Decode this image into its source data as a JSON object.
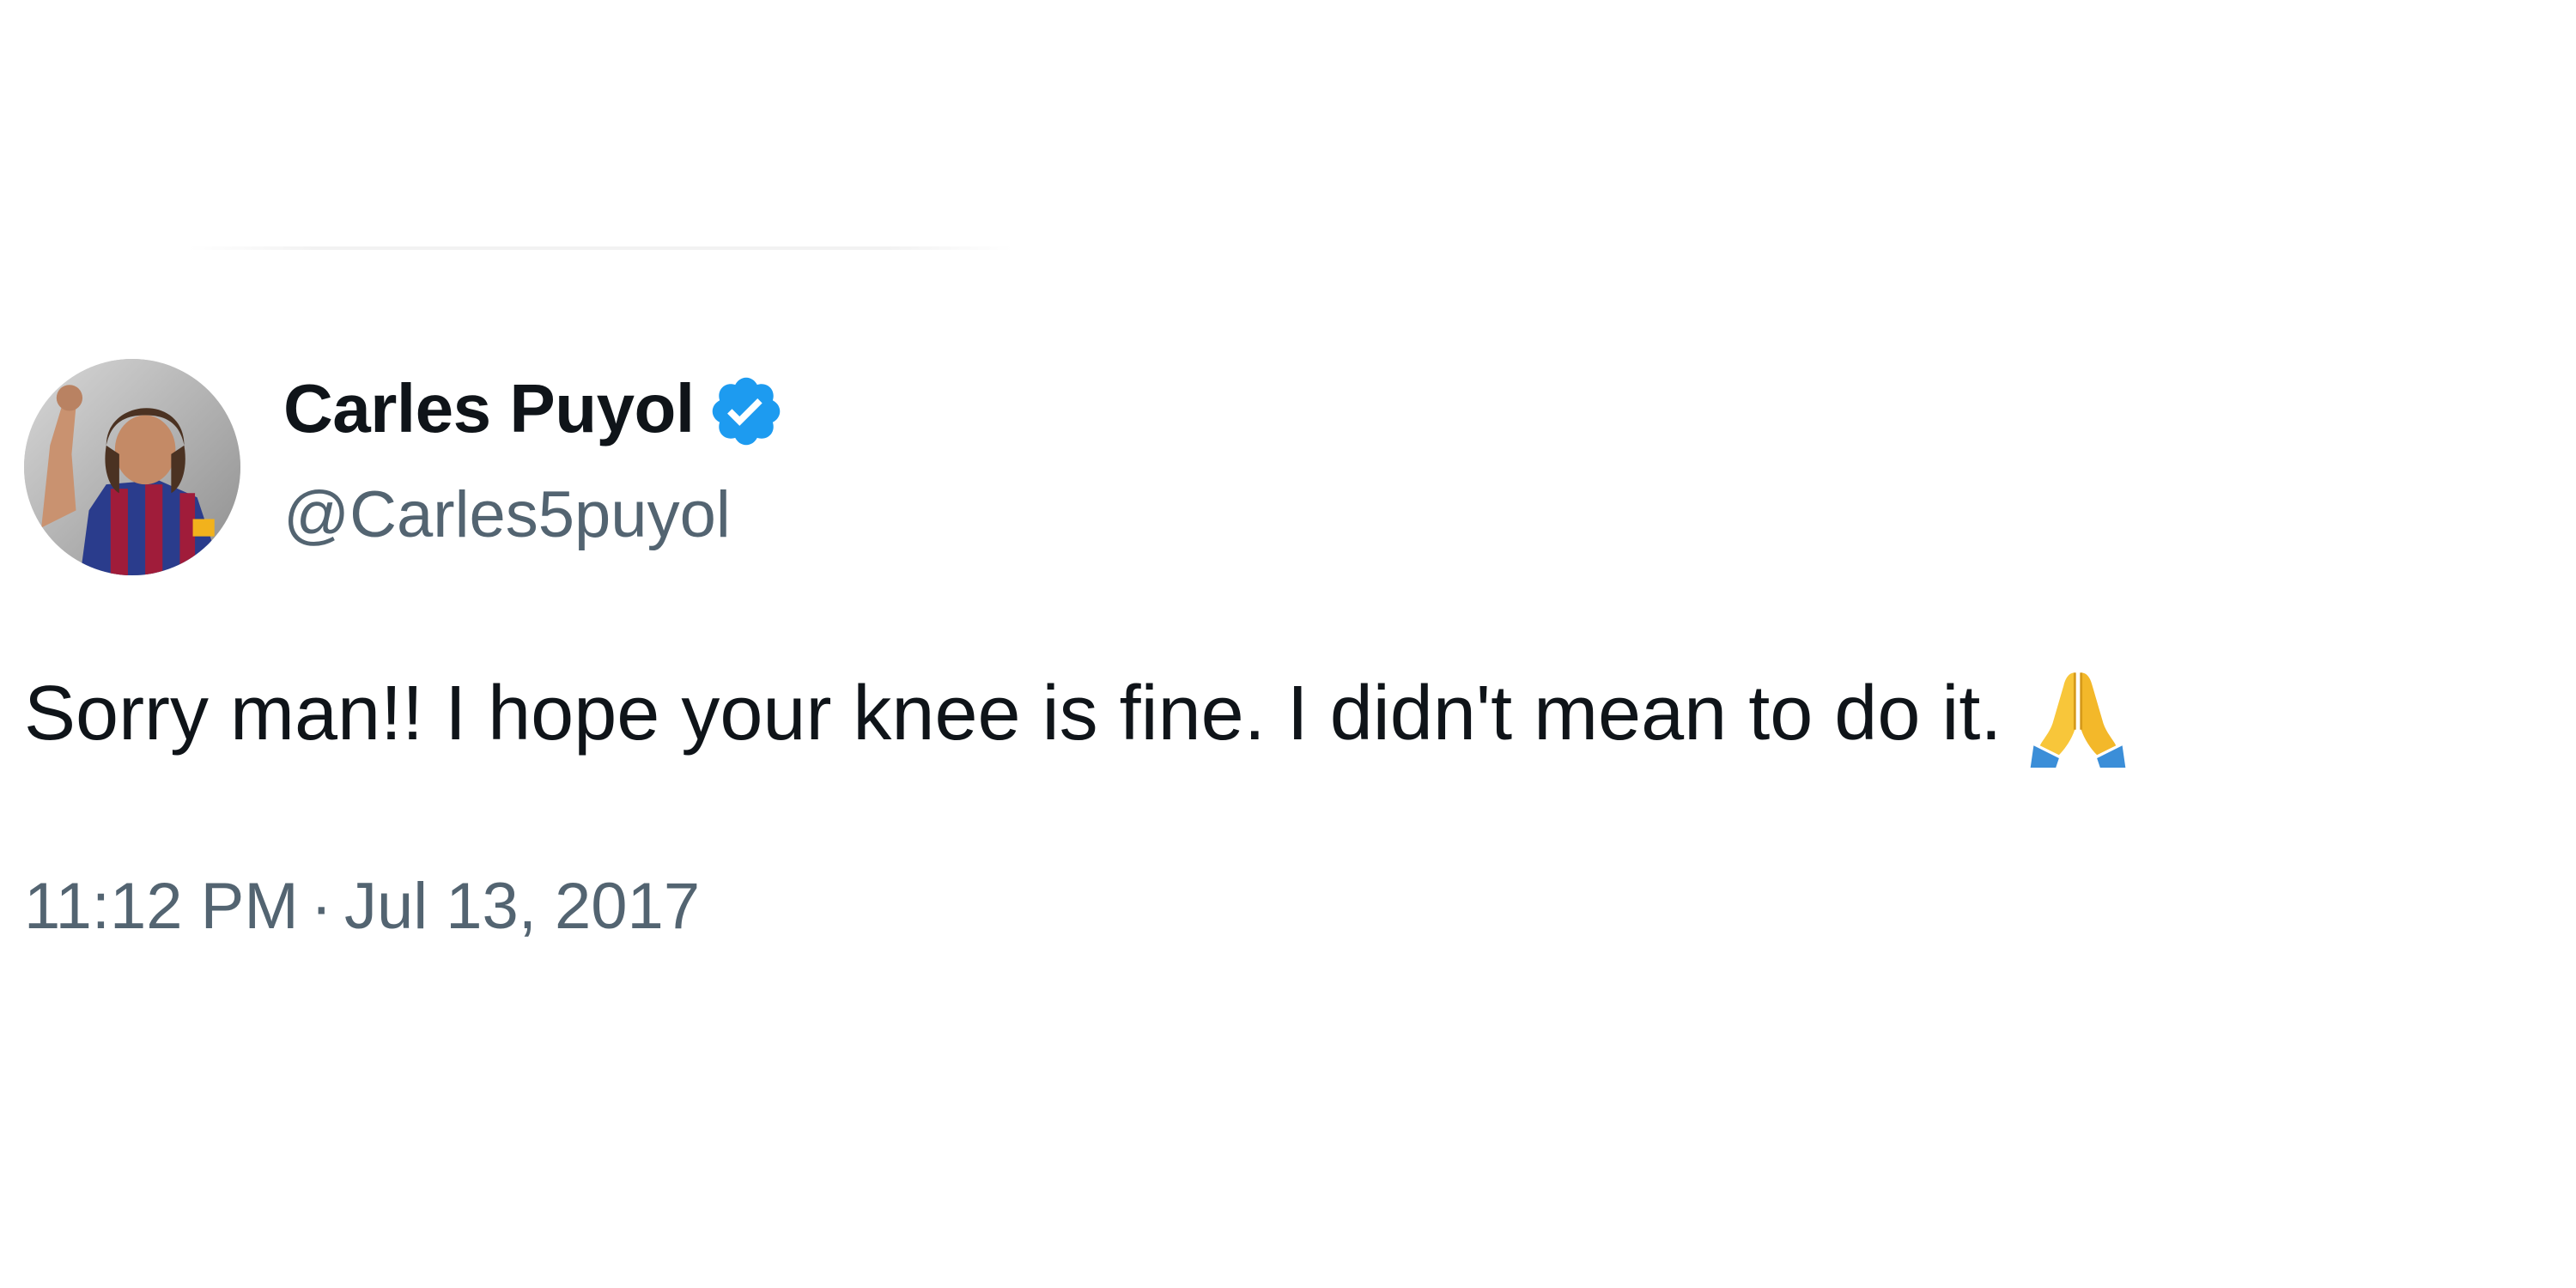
{
  "tweet": {
    "author": {
      "display_name": "Carles Puyol",
      "handle": "@Carles5puyol",
      "verified": true,
      "avatar_icon": "profile-photo-avatar",
      "verified_icon": "verified-badge-icon"
    },
    "text": "Sorry man!! I hope your knee is fine.  I didn't mean to do it.",
    "emoji_icon": "folded-hands-emoji",
    "time": "11:12 PM",
    "separator": "·",
    "date": "Jul 13, 2017"
  },
  "colors": {
    "text_primary": "#0f1419",
    "text_secondary": "#536471",
    "verified_blue": "#1d9bf0",
    "background": "#ffffff"
  }
}
